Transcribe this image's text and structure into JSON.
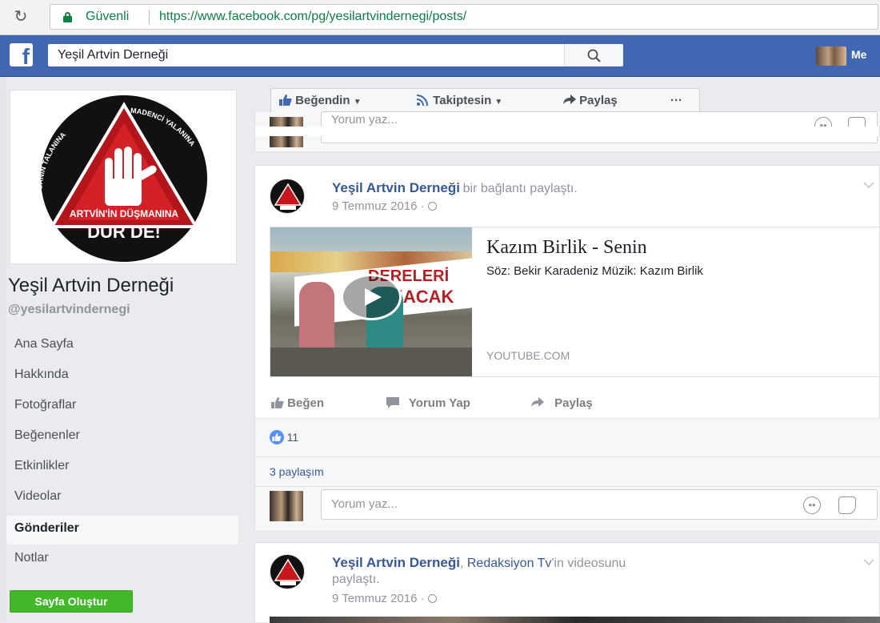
{
  "browser": {
    "secure_label": "Güvenli",
    "url": "https://www.facebook.com/pg/yesilartvindernegi/posts/"
  },
  "header": {
    "logo": "f",
    "search_value": "Yeşil Artvin Derneği",
    "user_name": "Me"
  },
  "profile": {
    "logo_arc_left": "DOĞANIN TALANINA",
    "logo_arc_right": "MADENCİ YALANINA",
    "logo_line1": "ARTVİN'İN DÜŞMANINA",
    "logo_line2": "DUR DE!",
    "name": "Yeşil Artvin Derneği",
    "handle": "@yesilartvindernegi"
  },
  "nav": {
    "items": [
      "Ana Sayfa",
      "Hakkında",
      "Fotoğraflar",
      "Beğenenler",
      "Etkinlikler",
      "Videolar",
      "Gönderiler",
      "Notlar"
    ],
    "active_index": 6,
    "create_page": "Sayfa Oluştur"
  },
  "actions": {
    "liked": "Beğendin",
    "following": "Takiptesin",
    "share": "Paylaş",
    "more": "···"
  },
  "top_card": {
    "comment_placeholder": "Yorum yaz..."
  },
  "post1": {
    "author": "Yeşil Artvin Derneği",
    "action": "bir bağlantı paylaştı.",
    "date": "9 Temmuz 2016 ·",
    "link_title": "Kazım Birlik - Senin",
    "link_desc": "Söz: Bekir Karadeniz Müzik: Kazım Birlik",
    "link_domain": "YOUTUBE.COM",
    "banner_text": "DERELERİ",
    "banner_text2": "KACAK",
    "like_btn": "Beğen",
    "comment_btn": "Yorum Yap",
    "share_btn": "Paylaş",
    "like_count": "11",
    "shares": "3 paylaşım",
    "comment_placeholder": "Yorum yaz..."
  },
  "post2": {
    "author": "Yeşil Artvin Derneği",
    "action_prefix": ", ",
    "action_link": "Redaksiyon Tv",
    "action_suffix": "'in videosunu",
    "action_line2": "paylaştı.",
    "date": "9 Temmuz 2016 ·"
  },
  "colors": {
    "fb_blue": "#4267b2",
    "link_blue": "#365899",
    "secure_green": "#0b8043",
    "create_green": "#42b72a"
  },
  "icons": [
    "reload-icon",
    "lock-icon",
    "search-icon",
    "thumbs-up-icon",
    "rss-icon",
    "share-arrow-icon",
    "play-icon",
    "globe-icon",
    "comment-icon",
    "smiley-icon",
    "sticker-icon",
    "chevron-down-icon"
  ]
}
